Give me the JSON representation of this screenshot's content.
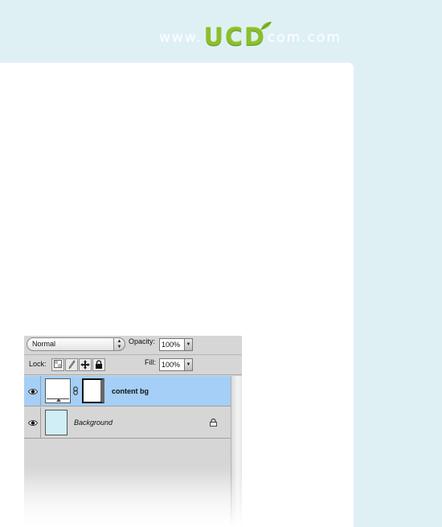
{
  "watermark": {
    "prefix": "www.",
    "logo_letters": [
      "U",
      "C",
      "D"
    ],
    "suffix": "com.com",
    "logo_color": "#8bbf2c"
  },
  "layers_panel": {
    "blend_mode": "Normal",
    "opacity_label": "Opacity:",
    "opacity_value": "100%",
    "lock_label": "Lock:",
    "fill_label": "Fill:",
    "fill_value": "100%",
    "lock_icons": [
      "lock-transparent-pixels-icon",
      "lock-image-pixels-icon",
      "lock-position-icon",
      "lock-all-icon"
    ],
    "layers": [
      {
        "name": "content bg",
        "selected": true,
        "visible": true,
        "has_mask": true,
        "icons": [
          "eye-icon",
          "link-icon"
        ]
      },
      {
        "name": "Background",
        "selected": false,
        "visible": true,
        "locked": true,
        "icons": [
          "eye-icon",
          "lock-icon"
        ]
      }
    ],
    "selection_color": "#a5cff6"
  },
  "colors": {
    "page_background": "#dff0f5",
    "content_background": "#ffffff",
    "panel_gray": "#d6d6d6",
    "background_swatch": "#cfeef5"
  }
}
